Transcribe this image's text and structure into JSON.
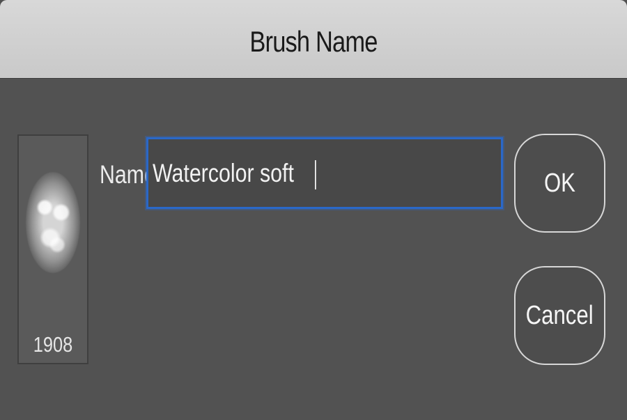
{
  "dialog": {
    "title": "Brush Name"
  },
  "brush": {
    "size_label": "1908",
    "preview_icon": "brush-preview-icon"
  },
  "form": {
    "name_label": "Name:",
    "name_value": "Watercolor soft"
  },
  "buttons": {
    "ok_label": "OK",
    "cancel_label": "Cancel"
  },
  "colors": {
    "accent": "#2a68c8",
    "dialog_bg": "#525252",
    "titlebar_bg": "#d8d8d8"
  }
}
